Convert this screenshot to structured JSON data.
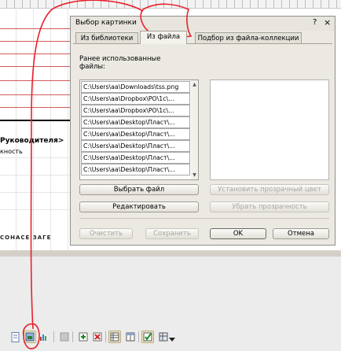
{
  "sheet": {
    "heading": "Руководителя>",
    "subtext": "кность",
    "partial_bottom": "СОНАСЕ ЗАГЕ"
  },
  "dialog": {
    "title": "Выбор картинки",
    "help_label": "?",
    "close_label": "×",
    "tabs": [
      {
        "label": "Из библиотеки",
        "active": false
      },
      {
        "label": "Из файла",
        "active": true
      },
      {
        "label": "Подбор из файла-коллекции",
        "active": false
      }
    ],
    "recent_label": "Ранее использованные файлы:",
    "files": [
      "C:\\Users\\aa\\Downloads\\tss.png",
      "C:\\Users\\aa\\Dropbox\\PO\\1c\\...",
      "C:\\Users\\aa\\Dropbox\\PO\\1c\\...",
      "C:\\Users\\aa\\Desktop\\Пласт\\...",
      "C:\\Users\\aa\\Desktop\\Пласт\\...",
      "C:\\Users\\aa\\Desktop\\Пласт\\...",
      "C:\\Users\\aa\\Desktop\\Пласт\\...",
      "C:\\Users\\aa\\Desktop\\Пласт\\..."
    ],
    "buttons": {
      "choose_file": "Выбрать файл",
      "edit": "Редактировать",
      "set_transparent": "Установить прозрачный цвет",
      "remove_transparency": "Убрать прозрачность",
      "clear": "Очистить",
      "save": "Сохранить",
      "ok": "OK",
      "cancel": "Отмена"
    }
  },
  "colors": {
    "annotation": "#e8212c",
    "dialog_bg": "#ece9e3",
    "grid_line": "#d35b5b"
  },
  "toolbar": {
    "icons": [
      "doc-icon",
      "cell-picture-icon",
      "chart-icon",
      "grey-icon",
      "insert-row-icon",
      "delete-row-icon",
      "table-grid-icon",
      "table-layout-icon",
      "check-table-icon",
      "more-table-icon",
      "dropdown-arrow-icon"
    ]
  }
}
